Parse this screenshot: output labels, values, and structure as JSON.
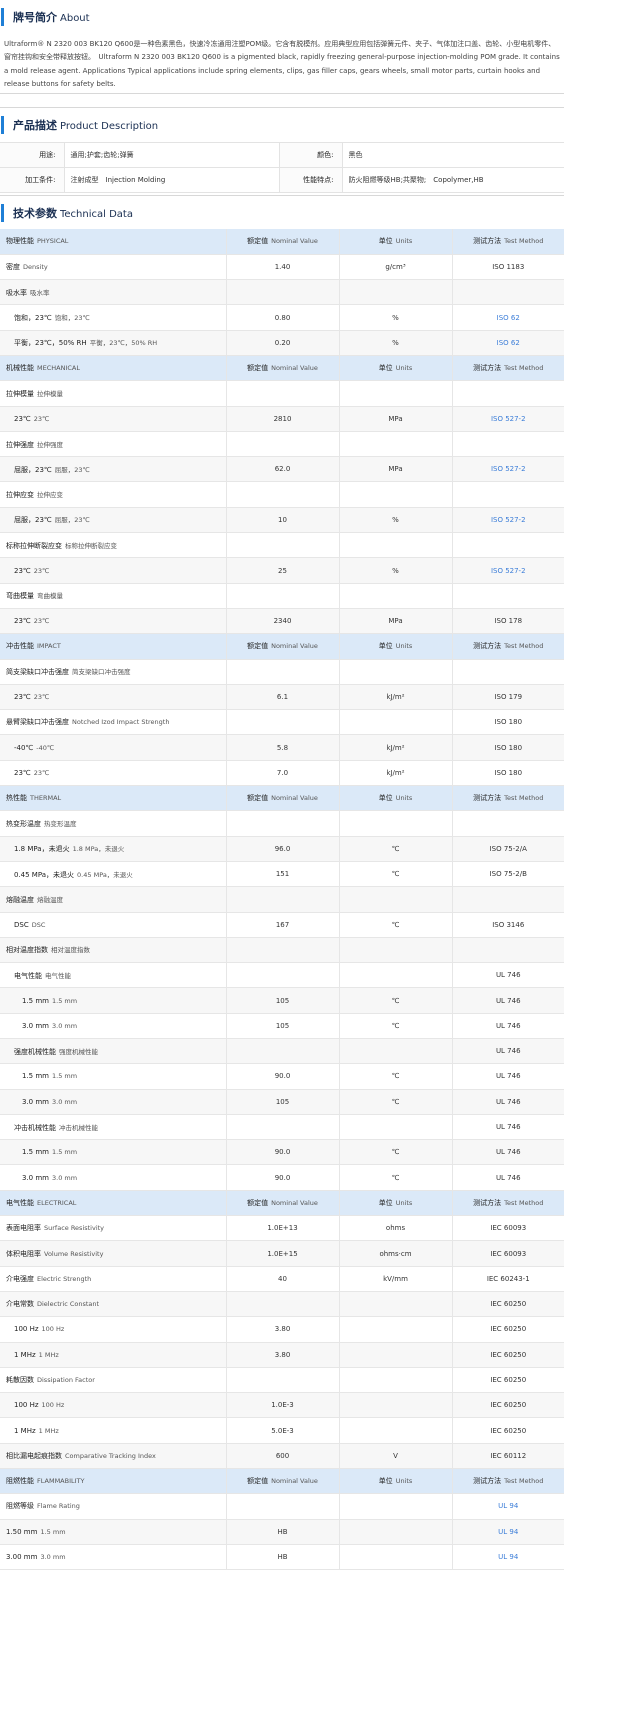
{
  "about": {
    "title_zh": "牌号简介",
    "title_en": "About",
    "text": "Ultraform® N 2320 003 BK120 Q600是一种色素黑色，快速冷冻通用注塑POM级。它含有脱模剂。应用典型应用包括弹簧元件、夹子、气体加注口盖、齿轮、小型电机零件、窗帘挂钩和安全带释放按钮。　Ultraform N 2320 003 BK120 Q600 is a pigmented black, rapidly freezing general-purpose injection-molding POM grade. It contains a mold release agent. Applications Typical applications include spring elements, clips, gas filler caps, gears wheels, small motor parts, curtain hooks and release buttons for safety belts."
  },
  "description": {
    "title_zh": "产品描述",
    "title_en": "Product Description",
    "rows": [
      {
        "l1": "用途:",
        "v1": "通用;护套;齿轮;弹簧",
        "l2": "颜色:",
        "v2": "黑色"
      },
      {
        "l1": "加工条件:",
        "v1": "注射成型　Injection Molding",
        "l2": "性能特点:",
        "v2": "防火阻燃等级HB;共聚物;　Copolymer,HB"
      }
    ]
  },
  "technical": {
    "title_zh": "技术参数",
    "title_en": "Technical Data",
    "header": {
      "value_zh": "额定值",
      "value_en": "Nominal Value",
      "unit_zh": "单位",
      "unit_en": "Units",
      "method_zh": "测试方法",
      "method_en": "Test Method"
    },
    "rows": [
      {
        "type": "cat",
        "zh": "物理性能",
        "en": "PHYSICAL"
      },
      {
        "type": "row",
        "zh": "密度",
        "en": "Density",
        "indent": 0,
        "value": "1.40",
        "unit": "g/cm³",
        "method": "ISO 1183",
        "link": false
      },
      {
        "type": "row",
        "zh": "吸水率",
        "en": "吸水率",
        "indent": 0,
        "value": "",
        "unit": "",
        "method": "",
        "link": false
      },
      {
        "type": "row",
        "zh": "饱和，23℃",
        "en": "饱和，23℃",
        "indent": 1,
        "value": "0.80",
        "unit": "%",
        "method": "ISO 62",
        "link": true
      },
      {
        "type": "row",
        "zh": "平衡，23℃，50% RH",
        "en": "平衡，23℃，50% RH",
        "indent": 1,
        "value": "0.20",
        "unit": "%",
        "method": "ISO 62",
        "link": true
      },
      {
        "type": "cat",
        "zh": "机械性能",
        "en": "MECHANICAL"
      },
      {
        "type": "row",
        "zh": "拉伸模量",
        "en": "拉伸模量",
        "indent": 0,
        "value": "",
        "unit": "",
        "method": "",
        "link": false
      },
      {
        "type": "row",
        "zh": "23℃",
        "en": "23℃",
        "indent": 1,
        "value": "2810",
        "unit": "MPa",
        "method": "ISO 527-2",
        "link": true
      },
      {
        "type": "row",
        "zh": "拉伸强度",
        "en": "拉伸强度",
        "indent": 0,
        "value": "",
        "unit": "",
        "method": "",
        "link": false
      },
      {
        "type": "row",
        "zh": "屈服，23℃",
        "en": "屈服，23℃",
        "indent": 1,
        "value": "62.0",
        "unit": "MPa",
        "method": "ISO 527-2",
        "link": true
      },
      {
        "type": "row",
        "zh": "拉伸应变",
        "en": "拉伸应变",
        "indent": 0,
        "value": "",
        "unit": "",
        "method": "",
        "link": false
      },
      {
        "type": "row",
        "zh": "屈服，23℃",
        "en": "屈服，23℃",
        "indent": 1,
        "value": "10",
        "unit": "%",
        "method": "ISO 527-2",
        "link": true
      },
      {
        "type": "row",
        "zh": "标称拉伸断裂应变",
        "en": "标称拉伸断裂应变",
        "indent": 0,
        "value": "",
        "unit": "",
        "method": "",
        "link": false
      },
      {
        "type": "row",
        "zh": "23℃",
        "en": "23℃",
        "indent": 1,
        "value": "25",
        "unit": "%",
        "method": "ISO 527-2",
        "link": true
      },
      {
        "type": "row",
        "zh": "弯曲模量",
        "en": "弯曲模量",
        "indent": 0,
        "value": "",
        "unit": "",
        "method": "",
        "link": false
      },
      {
        "type": "row",
        "zh": "23℃",
        "en": "23℃",
        "indent": 1,
        "value": "2340",
        "unit": "MPa",
        "method": "ISO 178",
        "link": false
      },
      {
        "type": "cat",
        "zh": "冲击性能",
        "en": "IMPACT"
      },
      {
        "type": "row",
        "zh": "简支梁缺口冲击强度",
        "en": "简支梁缺口冲击强度",
        "indent": 0,
        "value": "",
        "unit": "",
        "method": "",
        "link": false
      },
      {
        "type": "row",
        "zh": "23℃",
        "en": "23℃",
        "indent": 1,
        "value": "6.1",
        "unit": "kJ/m²",
        "method": "ISO 179",
        "link": false
      },
      {
        "type": "row",
        "zh": "悬臂梁缺口冲击强度",
        "en": "Notched Izod Impact Strength",
        "indent": 0,
        "value": "",
        "unit": "",
        "method": "ISO 180",
        "link": false
      },
      {
        "type": "row",
        "zh": "-40℃",
        "en": "-40℃",
        "indent": 1,
        "value": "5.8",
        "unit": "kJ/m²",
        "method": "ISO 180",
        "link": false
      },
      {
        "type": "row",
        "zh": "23℃",
        "en": "23℃",
        "indent": 1,
        "value": "7.0",
        "unit": "kJ/m²",
        "method": "ISO 180",
        "link": false
      },
      {
        "type": "cat",
        "zh": "热性能",
        "en": "THERMAL"
      },
      {
        "type": "row",
        "zh": "热变形温度",
        "en": "热变形温度",
        "indent": 0,
        "value": "",
        "unit": "",
        "method": "",
        "link": false
      },
      {
        "type": "row",
        "zh": "1.8 MPa，未退火",
        "en": "1.8 MPa，未退火",
        "indent": 1,
        "value": "96.0",
        "unit": "℃",
        "method": "ISO 75-2/A",
        "link": false
      },
      {
        "type": "row",
        "zh": "0.45 MPa，未退火",
        "en": "0.45 MPa，未退火",
        "indent": 1,
        "value": "151",
        "unit": "℃",
        "method": "ISO 75-2/B",
        "link": false
      },
      {
        "type": "row",
        "zh": "熔融温度",
        "en": "熔融温度",
        "indent": 0,
        "value": "",
        "unit": "",
        "method": "",
        "link": false
      },
      {
        "type": "row",
        "zh": "DSC",
        "en": "DSC",
        "indent": 1,
        "value": "167",
        "unit": "℃",
        "method": "ISO 3146",
        "link": false
      },
      {
        "type": "row",
        "zh": "相对温度指数",
        "en": "相对温度指数",
        "indent": 0,
        "value": "",
        "unit": "",
        "method": "",
        "link": false
      },
      {
        "type": "row",
        "zh": "电气性能",
        "en": "电气性能",
        "indent": 1,
        "value": "",
        "unit": "",
        "method": "UL 746",
        "link": false
      },
      {
        "type": "row",
        "zh": "1.5 mm",
        "en": "1.5 mm",
        "indent": 2,
        "value": "105",
        "unit": "℃",
        "method": "UL 746",
        "link": false
      },
      {
        "type": "row",
        "zh": "3.0 mm",
        "en": "3.0 mm",
        "indent": 2,
        "value": "105",
        "unit": "℃",
        "method": "UL 746",
        "link": false
      },
      {
        "type": "row",
        "zh": "强度机械性能",
        "en": "强度机械性能",
        "indent": 1,
        "value": "",
        "unit": "",
        "method": "UL 746",
        "link": false
      },
      {
        "type": "row",
        "zh": "1.5 mm",
        "en": "1.5 mm",
        "indent": 2,
        "value": "90.0",
        "unit": "℃",
        "method": "UL 746",
        "link": false
      },
      {
        "type": "row",
        "zh": "3.0 mm",
        "en": "3.0 mm",
        "indent": 2,
        "value": "105",
        "unit": "℃",
        "method": "UL 746",
        "link": false
      },
      {
        "type": "row",
        "zh": "冲击机械性能",
        "en": "冲击机械性能",
        "indent": 1,
        "value": "",
        "unit": "",
        "method": "UL 746",
        "link": false
      },
      {
        "type": "row",
        "zh": "1.5 mm",
        "en": "1.5 mm",
        "indent": 2,
        "value": "90.0",
        "unit": "℃",
        "method": "UL 746",
        "link": false
      },
      {
        "type": "row",
        "zh": "3.0 mm",
        "en": "3.0 mm",
        "indent": 2,
        "value": "90.0",
        "unit": "℃",
        "method": "UL 746",
        "link": false
      },
      {
        "type": "cat",
        "zh": "电气性能",
        "en": "ELECTRICAL"
      },
      {
        "type": "row",
        "zh": "表面电阻率",
        "en": "Surface Resistivity",
        "indent": 0,
        "value": "1.0E+13",
        "unit": "ohms",
        "method": "IEC 60093",
        "link": false
      },
      {
        "type": "row",
        "zh": "体积电阻率",
        "en": "Volume Resistivity",
        "indent": 0,
        "value": "1.0E+15",
        "unit": "ohms·cm",
        "method": "IEC 60093",
        "link": false
      },
      {
        "type": "row",
        "zh": "介电强度",
        "en": "Electric Strength",
        "indent": 0,
        "value": "40",
        "unit": "kV/mm",
        "method": "IEC 60243-1",
        "link": false
      },
      {
        "type": "row",
        "zh": "介电常数",
        "en": "Dielectric Constant",
        "indent": 0,
        "value": "",
        "unit": "",
        "method": "IEC 60250",
        "link": false
      },
      {
        "type": "row",
        "zh": "100 Hz",
        "en": "100 Hz",
        "indent": 1,
        "value": "3.80",
        "unit": "",
        "method": "IEC 60250",
        "link": false
      },
      {
        "type": "row",
        "zh": "1 MHz",
        "en": "1 MHz",
        "indent": 1,
        "value": "3.80",
        "unit": "",
        "method": "IEC 60250",
        "link": false
      },
      {
        "type": "row",
        "zh": "耗散因数",
        "en": "Dissipation Factor",
        "indent": 0,
        "value": "",
        "unit": "",
        "method": "IEC 60250",
        "link": false
      },
      {
        "type": "row",
        "zh": "100 Hz",
        "en": "100 Hz",
        "indent": 1,
        "value": "1.0E-3",
        "unit": "",
        "method": "IEC 60250",
        "link": false
      },
      {
        "type": "row",
        "zh": "1 MHz",
        "en": "1 MHz",
        "indent": 1,
        "value": "5.0E-3",
        "unit": "",
        "method": "IEC 60250",
        "link": false
      },
      {
        "type": "row",
        "zh": "相比漏电起痕指数",
        "en": "Comparative Tracking Index",
        "indent": 0,
        "value": "600",
        "unit": "V",
        "method": "IEC 60112",
        "link": false
      },
      {
        "type": "cat",
        "zh": "阻燃性能",
        "en": "FLAMMABILITY"
      },
      {
        "type": "row",
        "zh": "阻燃等级",
        "en": "Flame Rating",
        "indent": 0,
        "value": "",
        "unit": "",
        "method": "UL 94",
        "link": true
      },
      {
        "type": "row",
        "zh": "1.50 mm",
        "en": "1.5 mm",
        "indent": 0,
        "value": "HB",
        "unit": "",
        "method": "UL 94",
        "link": true
      },
      {
        "type": "row",
        "zh": "3.00 mm",
        "en": "3.0 mm",
        "indent": 0,
        "value": "HB",
        "unit": "",
        "method": "UL 94",
        "link": true
      }
    ]
  }
}
